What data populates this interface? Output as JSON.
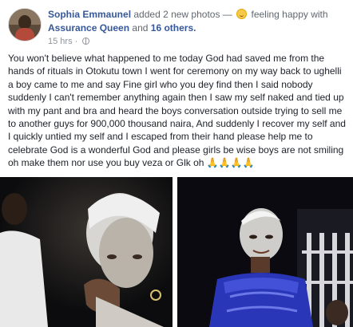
{
  "post": {
    "author": "Sophia Emmaunel",
    "action": "added 2 new photos —",
    "feeling": "feeling happy with",
    "tagged_user": "Assurance Queen",
    "connector": "and",
    "others": "16 others.",
    "time": "15 hrs",
    "privacy_icon": "globe-icon",
    "body": "You won't believe what happened to me today God had saved me from the hands of rituals in Otokutu town I went for ceremony on my way back to ughelli a boy came to me and say Fine girl who you dey find then I said nobody suddenly I can't remember anything again then I saw my self naked and tied up with my pant and bra and heard the boys conversation outside trying to sell me to another guys for 900,000 thousand naira, And suddenly I recover my self and I quickly untied my self and I escaped from their hand please help me to celebrate God is a wonderful God and please girls be wise boys are not smiling oh make them nor use you buy veza or Glk oh",
    "emoji_tail": "🙏🙏🙏🙏"
  },
  "photos": [
    {
      "name": "photo-left"
    },
    {
      "name": "photo-right"
    }
  ],
  "colors": {
    "link": "#365899",
    "text": "#1d2129",
    "meta": "#90949c"
  }
}
